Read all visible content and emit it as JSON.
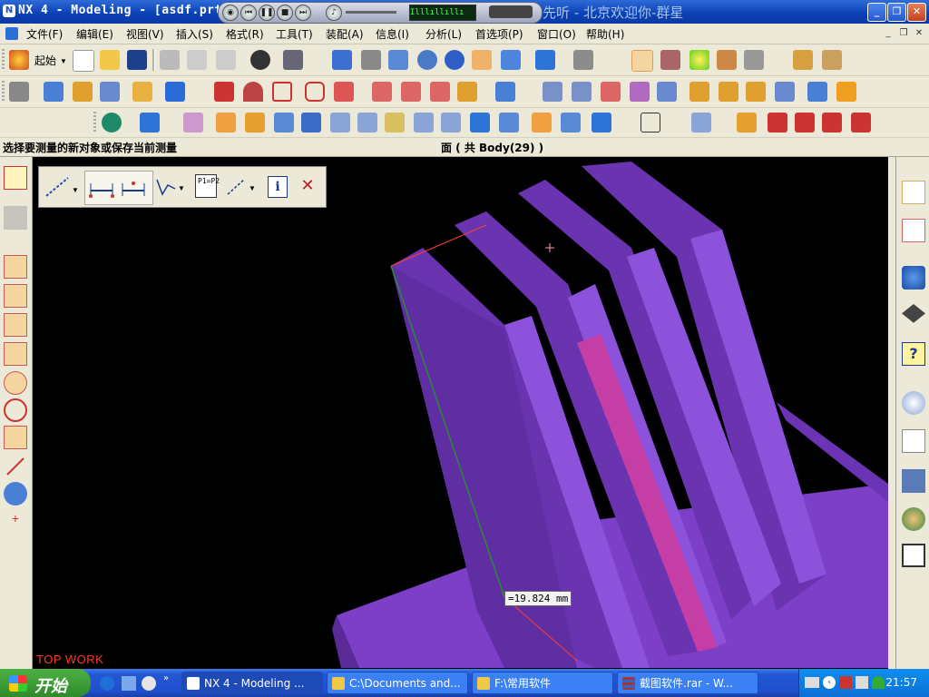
{
  "window": {
    "title": "NX 4 - Modeling - [asdf.prt",
    "ticker": "先听 - 北京欢迎你-群星",
    "buttons": {
      "minimize": "_",
      "restore": "❐",
      "close": "✕"
    },
    "eq_readout": "Illlıllıllı"
  },
  "menu": {
    "items": [
      "文件(F)",
      "编辑(E)",
      "视图(V)",
      "插入(S)",
      "格式(R)",
      "工具(T)",
      "装配(A)",
      "信息(I)",
      "分析(L)",
      "首选项(P)",
      "窗口(O)",
      "帮助(H)"
    ],
    "mdi": {
      "minimize": "_",
      "restore": "❐",
      "close": "✕"
    }
  },
  "toolbar": {
    "start_label": "起始"
  },
  "status": {
    "prompt": "选择要测量的新对象或保存当前测量",
    "selection": "面 ( 共 Body(29) )"
  },
  "measure_dialog": {
    "info_label": "i",
    "close_label": "✕",
    "p1p2_label": "P1=P2"
  },
  "viewport": {
    "measurement": "=19.824 mm",
    "view_label": "TOP WORK",
    "colors": {
      "fin": "#6a33b0",
      "fin_face": "#7a3ec4",
      "fin_edge": "#8c52dc",
      "base": "#7d3fc8",
      "highlight": "#c43ea6"
    }
  },
  "taskbar": {
    "start": "开始",
    "tasks": [
      "NX 4 - Modeling ...",
      "C:\\Documents and...",
      "F:\\常用软件",
      "截图软件.rar - W..."
    ],
    "clock": "21:57"
  }
}
